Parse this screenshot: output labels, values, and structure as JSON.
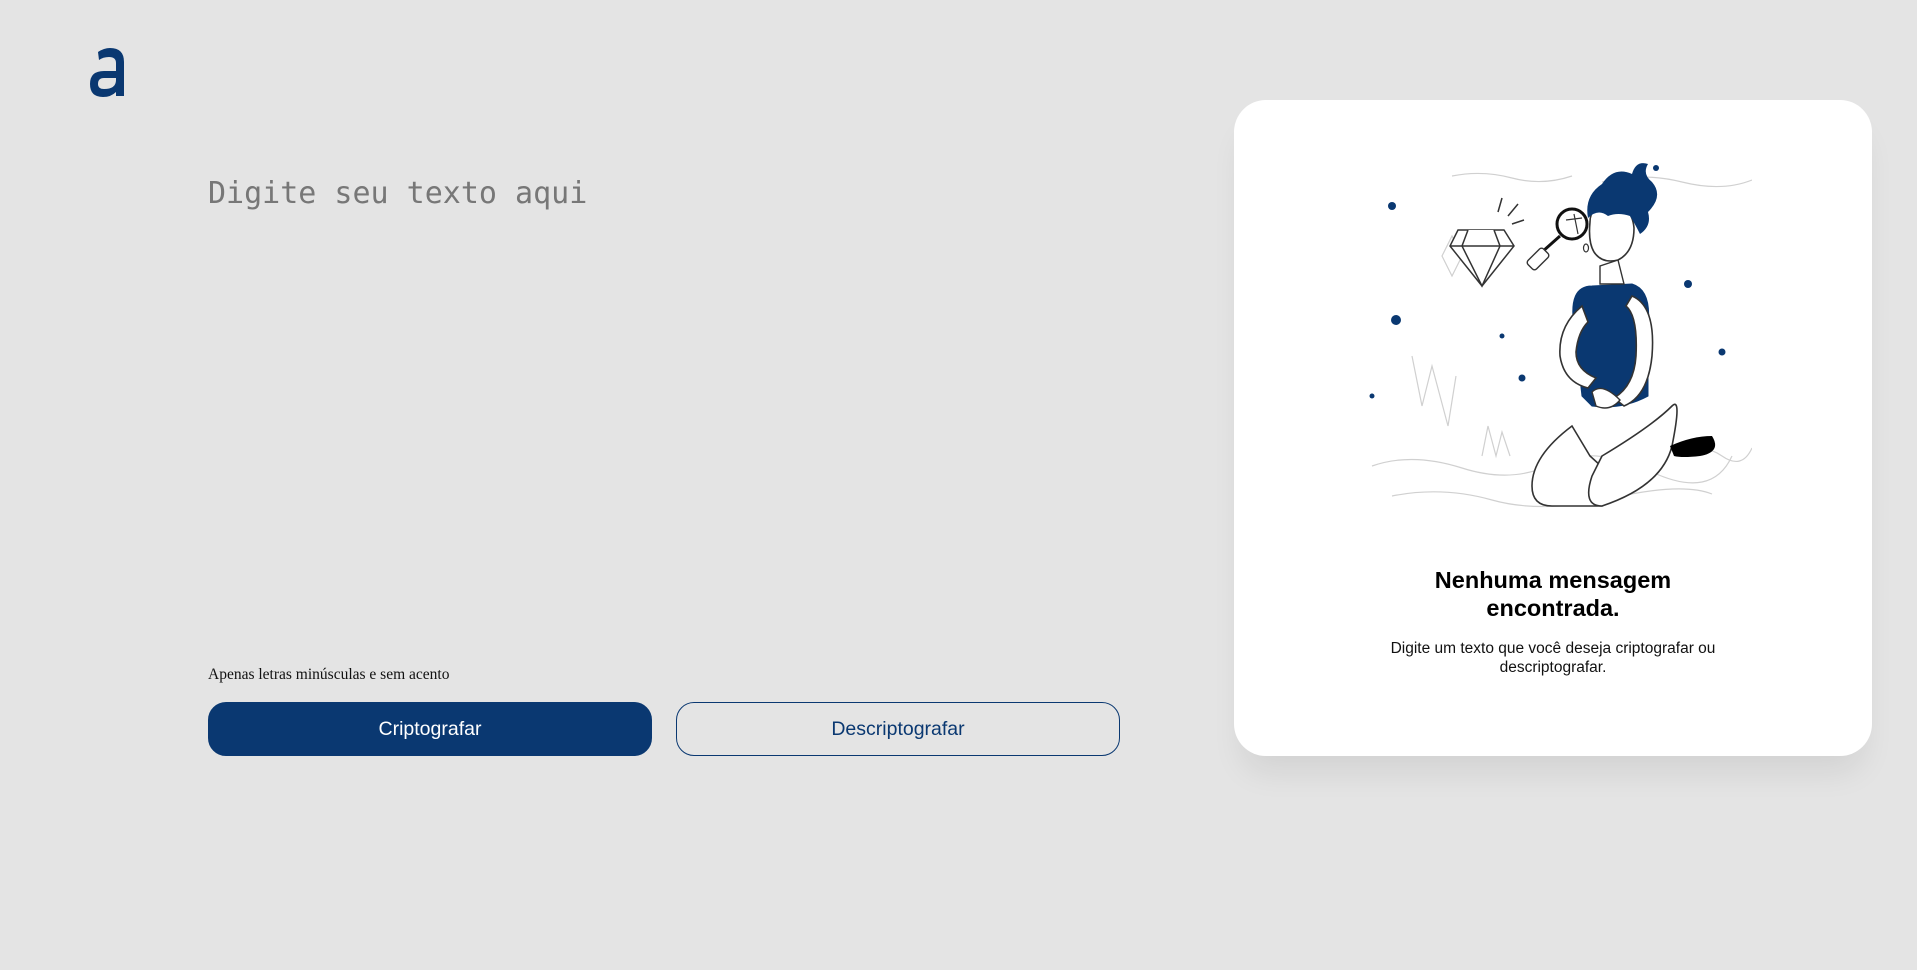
{
  "brand": {
    "logo_icon": "alura-a-logo-icon",
    "color": "#0a3871"
  },
  "editor": {
    "placeholder": "Digite seu texto aqui",
    "value": ""
  },
  "hint": {
    "text": "Apenas letras minúsculas e sem acento"
  },
  "actions": {
    "encrypt_label": "Criptografar",
    "decrypt_label": "Descriptografar"
  },
  "output_panel": {
    "illustration_icon": "person-with-magnifier-illustration",
    "title_line1": "Nenhuma mensagem",
    "title_line2": "encontrada.",
    "subtitle_line1": "Digite um texto que você deseja criptografar ou",
    "subtitle_line2": "descriptografar."
  },
  "colors": {
    "accent": "#0a3871",
    "background": "#e4e4e4",
    "card": "#ffffff"
  }
}
